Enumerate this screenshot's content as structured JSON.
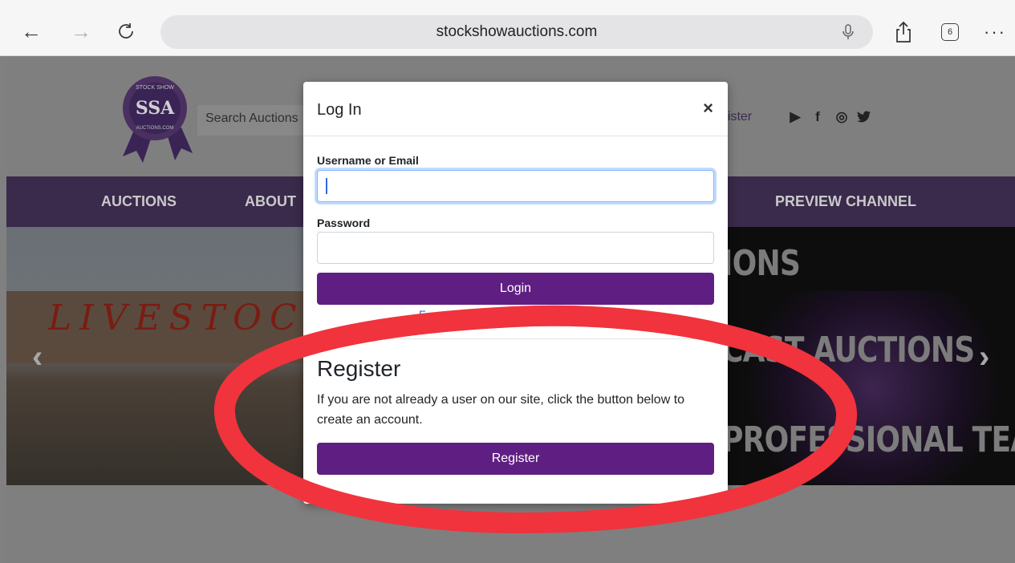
{
  "browser": {
    "url": "stockshowauctions.com",
    "tab_count": "6"
  },
  "site": {
    "logo_text": "SSA",
    "logo_ring_top": "STOCK SHOW",
    "logo_ring_bottom": "AUCTIONS.COM",
    "search_placeholder": "Search Auctions",
    "header_link": "gister",
    "nav": [
      "AUCTIONS",
      "ABOUT",
      "PREVIEW CHANNEL"
    ],
    "hero": {
      "photo_text": "LIVESTOCH",
      "line1": "IONS",
      "line2": "CAST AUCTIONS",
      "line3": "PROFESSIONAL TEAM"
    }
  },
  "modal": {
    "title": "Log In",
    "close": "×",
    "username_label": "Username or Email",
    "username_value": "",
    "password_label": "Password",
    "password_value": "",
    "login_button": "Login",
    "forgot_fragment": "F",
    "register_title": "Register",
    "register_text": "If you are not already a user on our site, click the button below to create an account.",
    "register_button": "Register"
  },
  "annotation": {
    "color": "#f0333c"
  }
}
